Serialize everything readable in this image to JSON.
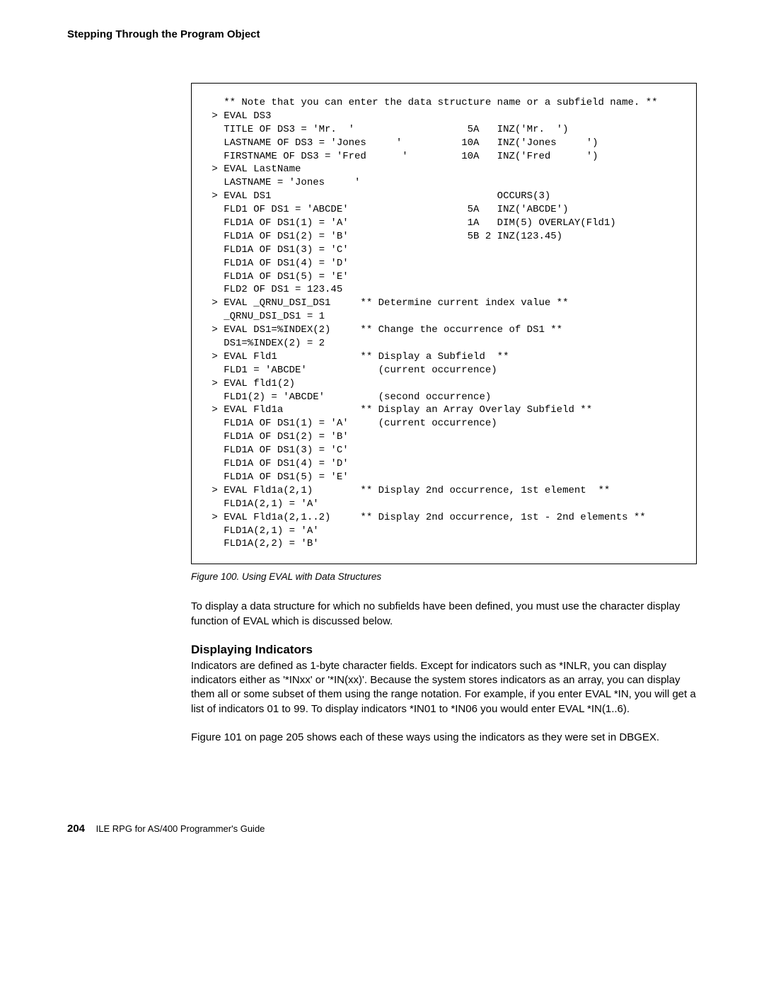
{
  "header": {
    "title": "Stepping Through the Program Object"
  },
  "figure": {
    "code": "   ** Note that you can enter the data structure name or a subfield name. **\n > EVAL DS3\n   TITLE OF DS3 = 'Mr.  '                   5A   INZ('Mr.  ')\n   LASTNAME OF DS3 = 'Jones     '          10A   INZ('Jones     ')\n   FIRSTNAME OF DS3 = 'Fred      '         10A   INZ('Fred      ')\n > EVAL LastName\n   LASTNAME = 'Jones     '\n > EVAL DS1                                      OCCURS(3)\n   FLD1 OF DS1 = 'ABCDE'                    5A   INZ('ABCDE')\n   FLD1A OF DS1(1) = 'A'                    1A   DIM(5) OVERLAY(Fld1)\n   FLD1A OF DS1(2) = 'B'                    5B 2 INZ(123.45)\n   FLD1A OF DS1(3) = 'C'\n   FLD1A OF DS1(4) = 'D'\n   FLD1A OF DS1(5) = 'E'\n   FLD2 OF DS1 = 123.45\n > EVAL _QRNU_DSI_DS1     ** Determine current index value **\n   _QRNU_DSI_DS1 = 1\n > EVAL DS1=%INDEX(2)     ** Change the occurrence of DS1 **\n   DS1=%INDEX(2) = 2\n > EVAL Fld1              ** Display a Subfield  **\n   FLD1 = 'ABCDE'            (current occurrence)\n > EVAL fld1(2)\n   FLD1(2) = 'ABCDE'         (second occurrence)\n > EVAL Fld1a             ** Display an Array Overlay Subfield **\n   FLD1A OF DS1(1) = 'A'     (current occurrence)\n   FLD1A OF DS1(2) = 'B'\n   FLD1A OF DS1(3) = 'C'\n   FLD1A OF DS1(4) = 'D'\n   FLD1A OF DS1(5) = 'E'\n > EVAL Fld1a(2,1)        ** Display 2nd occurrence, 1st element  **\n   FLD1A(2,1) = 'A'\n > EVAL Fld1a(2,1..2)     ** Display 2nd occurrence, 1st - 2nd elements **\n   FLD1A(2,1) = 'A'\n   FLD1A(2,2) = 'B'",
    "caption": "Figure 100. Using EVAL with Data Structures"
  },
  "paragraphs": {
    "p1": "To display a data structure for which no subfields have been defined, you must use the character display function of EVAL which is discussed below.",
    "heading": "Displaying Indicators",
    "p2": "Indicators are defined as 1-byte character fields. Except for indicators such as *INLR, you can display indicators either as '*INxx' or '*IN(xx)'. Because the system stores indicators as an array, you can display them all or some subset of them using the range notation. For example, if you enter EVAL *IN, you will get a list of indicators 01 to 99. To display indicators *IN01 to *IN06 you would enter EVAL *IN(1..6).",
    "p3": "Figure 101 on page 205 shows each of these ways using the indicators as they were set in DBGEX."
  },
  "footer": {
    "page": "204",
    "text": "ILE RPG for AS/400 Programmer's Guide"
  }
}
